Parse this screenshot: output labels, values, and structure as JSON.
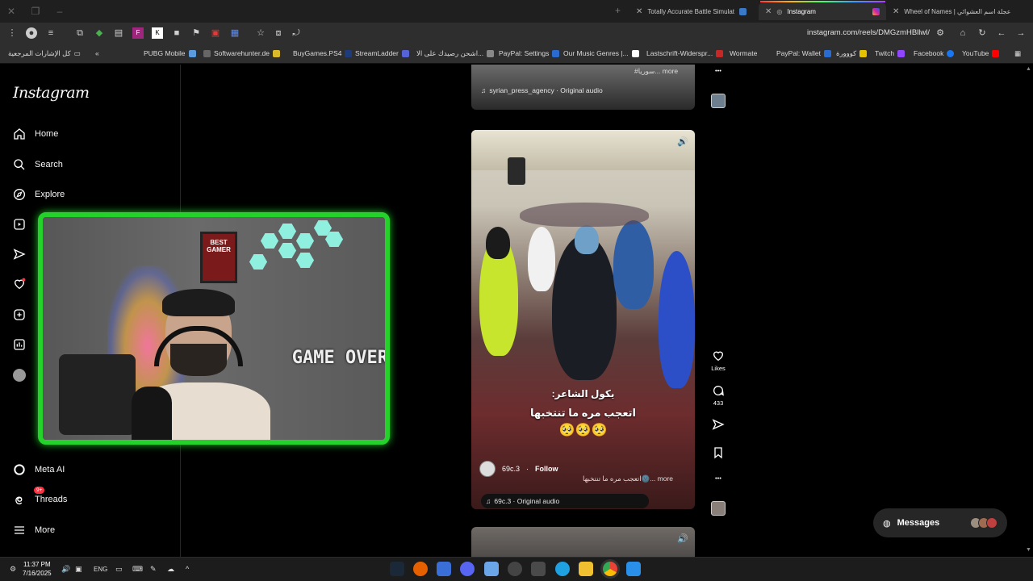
{
  "browser": {
    "tabs": [
      {
        "title": "Totally Accurate Battle Simulat",
        "active": false
      },
      {
        "title": "Instagram",
        "active": true
      },
      {
        "title": "Wheel of Names | عجلة اسم العشوائي",
        "active": false
      }
    ],
    "url": "instagram.com/reels/DMGzmHBllwl/",
    "bookmarks": [
      "كل الإشارات المرجعية",
      "PUBG Mobile",
      "Softwarehunter.de",
      "BuyGames.PS4",
      "StreamLadder",
      "اشحن رصيدك على الا...",
      "PayPal: Settings",
      "Our Music Genres |...",
      "Lastschrift-Widerspr...",
      "Wormate",
      "PayPal: Wallet",
      "كووورة",
      "Twitch",
      "Facebook",
      "YouTube"
    ]
  },
  "sidebar": {
    "logo": "Instagram",
    "items": [
      {
        "label": "Home",
        "icon": "home-icon"
      },
      {
        "label": "Search",
        "icon": "search-icon"
      },
      {
        "label": "Explore",
        "icon": "compass-icon"
      },
      {
        "label": "Meta AI",
        "icon": "meta-ai-icon"
      },
      {
        "label": "Threads",
        "icon": "threads-icon",
        "badge": "9+"
      },
      {
        "label": "More",
        "icon": "menu-icon"
      }
    ]
  },
  "webcam": {
    "poster_text": "BEST GAMER",
    "sign_text": "GAME OVER"
  },
  "reels": {
    "prev_more": "#سوريا... more",
    "prev_audio": "syrian_press_agency · Original audio",
    "current": {
      "overlay_line1": "يكول الشاعر:",
      "overlay_line2": "اتعجب مره ما تنتخبها",
      "overlay_emoji": "🥺🥺🥺",
      "username": "69c.3",
      "follow": "Follow",
      "caption": "اتعجب مره ما تنتخبها🌚... more",
      "audio": "69c.3 · Original audio",
      "likes_label": "Likes",
      "comments": "433"
    }
  },
  "messages": {
    "label": "Messages"
  },
  "taskbar": {
    "time": "11:37 PM",
    "date": "7/16/2025",
    "lang": "ENG"
  },
  "colors": {
    "cam_border": "#25d12b",
    "badge": "#ff3040",
    "page_bg": "#000000"
  }
}
